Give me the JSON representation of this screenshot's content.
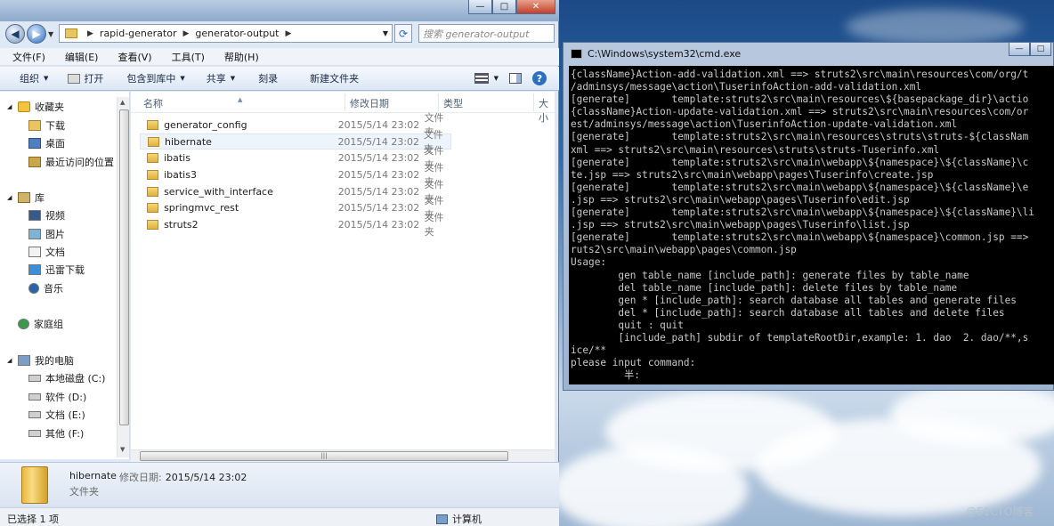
{
  "explorer": {
    "address": {
      "crumbs": [
        "rapid-generator",
        "generator-output"
      ],
      "search_placeholder": "搜索 generator-output"
    },
    "menu": [
      "文件(F)",
      "编辑(E)",
      "查看(V)",
      "工具(T)",
      "帮助(H)"
    ],
    "toolbar": {
      "organize": "组织",
      "open": "打开",
      "include_in_library": "包含到库中",
      "share": "共享",
      "burn": "刻录",
      "new_folder": "新建文件夹"
    },
    "nav": {
      "favorites": "收藏夹",
      "downloads": "下载",
      "desktop": "桌面",
      "recent": "最近访问的位置",
      "libraries": "库",
      "video": "视频",
      "pictures": "图片",
      "documents": "文档",
      "xunlei": "迅雷下载",
      "music": "音乐",
      "homegroup": "家庭组",
      "computer": "我的电脑",
      "drive_c": "本地磁盘 (C:)",
      "drive_d": "软件 (D:)",
      "drive_e": "文档 (E:)",
      "drive_f": "其他 (F:)"
    },
    "columns": {
      "name": "名称",
      "date": "修改日期",
      "type": "类型",
      "size": "大小"
    },
    "files": [
      {
        "name": "generator_config",
        "date": "2015/5/14 23:02",
        "type": "文件夹"
      },
      {
        "name": "hibernate",
        "date": "2015/5/14 23:02",
        "type": "文件夹"
      },
      {
        "name": "ibatis",
        "date": "2015/5/14 23:02",
        "type": "文件夹"
      },
      {
        "name": "ibatis3",
        "date": "2015/5/14 23:02",
        "type": "文件夹"
      },
      {
        "name": "service_with_interface",
        "date": "2015/5/14 23:02",
        "type": "文件夹"
      },
      {
        "name": "springmvc_rest",
        "date": "2015/5/14 23:02",
        "type": "文件夹"
      },
      {
        "name": "struts2",
        "date": "2015/5/14 23:02",
        "type": "文件夹"
      }
    ],
    "details": {
      "name": "hibernate",
      "modified_label": "修改日期:",
      "modified_value": "2015/5/14 23:02",
      "type": "文件夹"
    },
    "status": {
      "selected": "已选择 1 项",
      "location": "计算机"
    }
  },
  "cmd": {
    "title": "C:\\Windows\\system32\\cmd.exe",
    "lines": [
      "{className}Action-add-validation.xml ==> struts2\\src\\main\\resources\\com/org/t",
      "/adminsys/message\\action\\TuserinfoAction-add-validation.xml",
      "[generate]       template:struts2\\src\\main\\resources\\${basepackage_dir}\\actio",
      "{className}Action-update-validation.xml ==> struts2\\src\\main\\resources\\com/or",
      "est/adminsys/message\\action\\TuserinfoAction-update-validation.xml",
      "[generate]       template:struts2\\src\\main\\resources\\struts\\struts-${classNam",
      "xml ==> struts2\\src\\main\\resources\\struts\\struts-Tuserinfo.xml",
      "[generate]       template:struts2\\src\\main\\webapp\\${namespace}\\${className}\\c",
      "te.jsp ==> struts2\\src\\main\\webapp\\pages\\Tuserinfo\\create.jsp",
      "[generate]       template:struts2\\src\\main\\webapp\\${namespace}\\${className}\\e",
      ".jsp ==> struts2\\src\\main\\webapp\\pages\\Tuserinfo\\edit.jsp",
      "[generate]       template:struts2\\src\\main\\webapp\\${namespace}\\${className}\\li",
      ".jsp ==> struts2\\src\\main\\webapp\\pages\\Tuserinfo\\list.jsp",
      "[generate]       template:struts2\\src\\main\\webapp\\${namespace}\\common.jsp ==>",
      "ruts2\\src\\main\\webapp\\pages\\common.jsp",
      "Usage:",
      "        gen table_name [include_path]: generate files by table_name",
      "        del table_name [include_path]: delete files by table_name",
      "        gen * [include_path]: search database all tables and generate files",
      "        del * [include_path]: search database all tables and delete files",
      "        quit : quit",
      "        [include_path] subdir of templateRootDir,example: 1. dao  2. dao/**,s",
      "ice/**",
      "please input command:",
      "         半:"
    ]
  },
  "watermark": "@51CTO博客"
}
